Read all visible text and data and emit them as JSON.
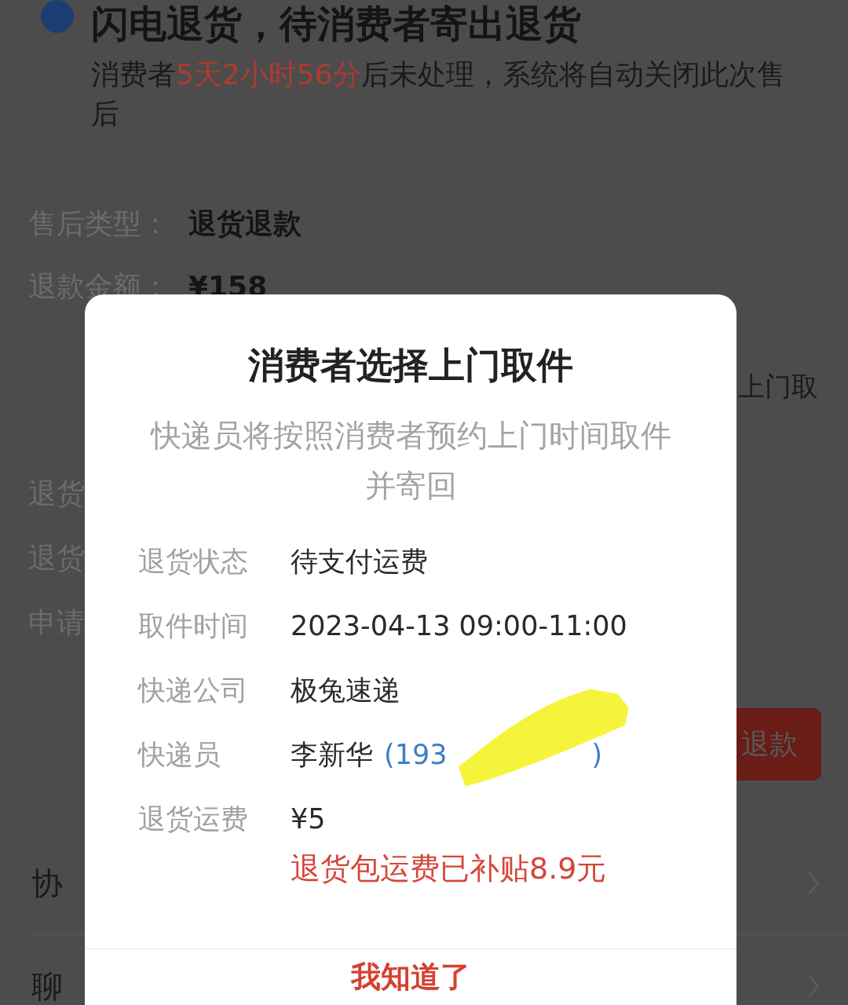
{
  "status_header": {
    "title": "闪电退货，待消费者寄出退货",
    "notice_parts": [
      {
        "text": "消费者",
        "highlight": false
      },
      {
        "text": "5天2小时56分",
        "highlight": true
      },
      {
        "text": "后未处理，系统将自动关闭此次售后",
        "highlight": false
      }
    ]
  },
  "details": [
    {
      "label": "售后类型：",
      "value": "退货退款"
    },
    {
      "label": "退款金额：",
      "value": "¥158"
    }
  ],
  "partial_right_text": "上门取",
  "partial_labels": [
    "退货",
    "退货",
    "申请"
  ],
  "action_button": "退款",
  "menu_items": [
    "协",
    "聊"
  ],
  "dialog": {
    "title": "消费者选择上门取件",
    "description": "快递员将按照消费者预约上门时间取件并寄回",
    "rows": [
      {
        "kind": "text",
        "label": "退货状态",
        "value": "待支付运费"
      },
      {
        "kind": "text",
        "label": "取件时间",
        "value": "2023-04-13 09:00-11:00"
      },
      {
        "kind": "text",
        "label": "快递公司",
        "value": "极兔速递"
      },
      {
        "kind": "courier",
        "label": "快递员",
        "value": "李新华",
        "phone_start": "(193",
        "phone_end": ")"
      },
      {
        "kind": "fee",
        "label": "退货运费",
        "value": "¥5",
        "note": "退货包运费已补贴8.9元"
      }
    ],
    "button": "我知道了"
  }
}
